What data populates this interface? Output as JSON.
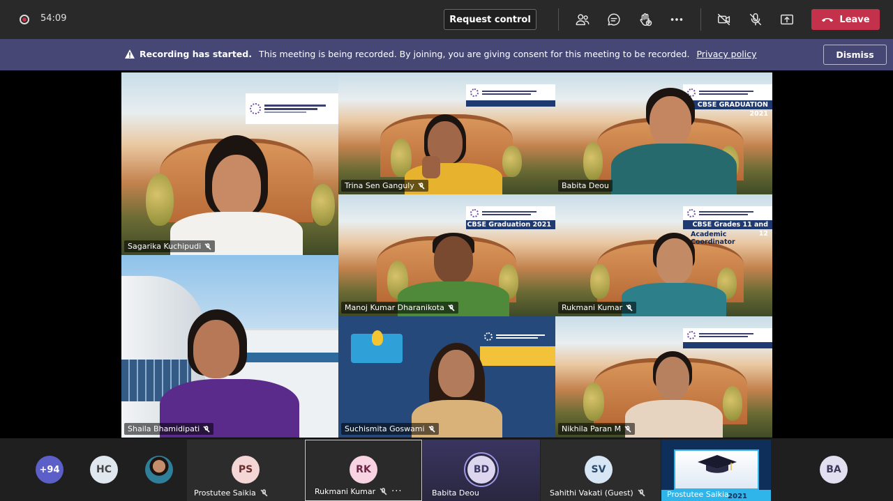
{
  "topbar": {
    "timer": "54:09",
    "request_control_label": "Request control",
    "leave_label": "Leave",
    "icons": [
      "people-icon",
      "chat-icon",
      "reactions-icon",
      "more-icon",
      "camera-off-icon",
      "mic-off-icon",
      "share-icon"
    ]
  },
  "banner": {
    "strong": "Recording has started.",
    "text": "This meeting is being recorded. By joining, you are giving consent for this meeting to be recorded.",
    "link": "Privacy policy",
    "dismiss_label": "Dismiss"
  },
  "tiles": {
    "t1": {
      "name": "Sagarika Kuchipudi"
    },
    "t2": {
      "name": "Trina Sen Ganguly"
    },
    "t3": {
      "name": "Babita Deou",
      "banner": "CBSE GRADUATION 2021"
    },
    "t4": {
      "name": "Manoj Kumar Dharanikota",
      "banner": "CBSE Graduation 2021"
    },
    "t5": {
      "name": "Rukmani Kumar",
      "banner": "CBSE Grades 11 and 12",
      "sub": "Academic Coordinator"
    },
    "t6": {
      "name": "Shaila Bhamidipati"
    },
    "t7": {
      "name": "Suchismita Goswami"
    },
    "t8": {
      "name": "Nikhila Paran M"
    }
  },
  "strip": {
    "more_count": "+94",
    "hc_initials": "HC",
    "participants": [
      {
        "initials": "PS",
        "name": "Prostutee Saikia"
      },
      {
        "initials": "RK",
        "name": "Rukmani Kumar"
      },
      {
        "initials": "BD",
        "name": "Babita Deou"
      },
      {
        "initials": "SV",
        "name": "Sahithi Vakati (Guest)"
      }
    ],
    "share_name": "Prostutee Saikia",
    "share_year": "2021",
    "ba_initials": "BA"
  },
  "colors": {
    "accent": "#464775",
    "leave": "#c4314b",
    "topbar": "#292929"
  }
}
